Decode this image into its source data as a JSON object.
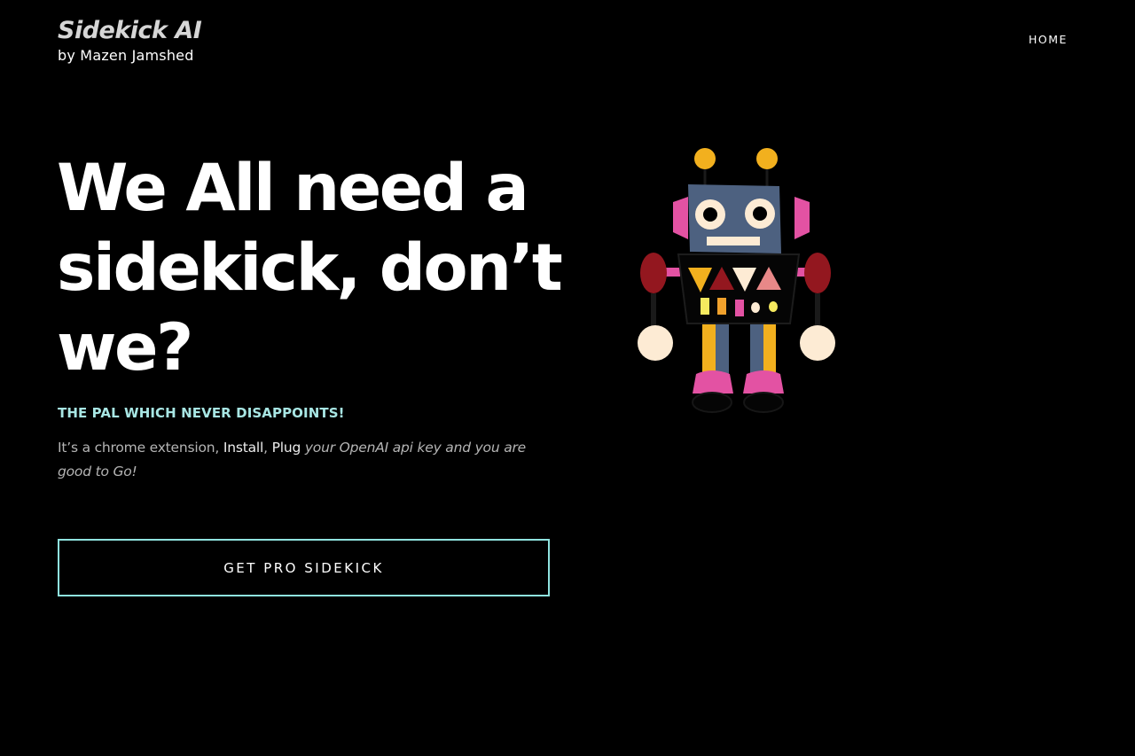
{
  "header": {
    "brand_title": "Sidekick AI",
    "brand_subtitle": "by Mazen Jamshed",
    "nav_home": "HOME"
  },
  "hero": {
    "title_line1": "We All need a",
    "title_line2": "sidekick, don’t",
    "title_line3": "we?",
    "tagline": "THE PAL WHICH NEVER DISAPPOINTS!",
    "desc_part1": "It’s a chrome extension, ",
    "desc_install": "Install",
    "desc_comma": ", ",
    "desc_plug": "Plug",
    "desc_italic": " your OpenAI api key and you are good to Go!",
    "cta_label": "GET PRO SIDEKICK"
  },
  "illustration": {
    "name": "robot-illustration"
  },
  "colors": {
    "background": "#000000",
    "accent": "#8fe3df",
    "tagline": "#a8e6e4",
    "robot_head": "#4d6180",
    "robot_pink": "#e352a3",
    "robot_yellow": "#f2b01e",
    "robot_red": "#93171f",
    "robot_cream": "#fdebd4"
  }
}
